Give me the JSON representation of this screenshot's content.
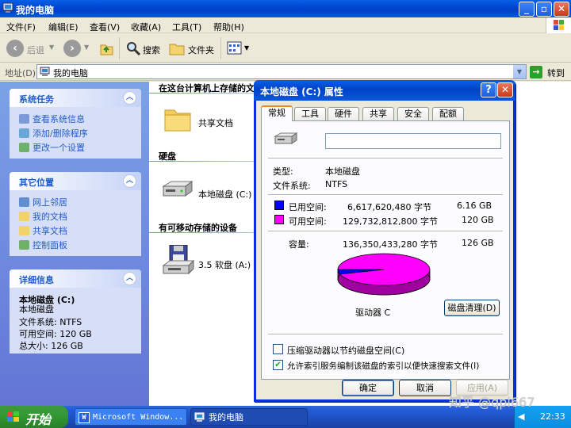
{
  "window": {
    "title": "我的电脑"
  },
  "menu": [
    "文件(F)",
    "编辑(E)",
    "查看(V)",
    "收藏(A)",
    "工具(T)",
    "帮助(H)"
  ],
  "toolbar": {
    "back": "后退",
    "search": "搜索",
    "folders": "文件夹"
  },
  "address": {
    "label": "地址(D)",
    "value": "我的电脑",
    "go": "转到"
  },
  "left": {
    "system_tasks": {
      "title": "系统任务",
      "items": [
        "查看系统信息",
        "添加/删除程序",
        "更改一个设置"
      ]
    },
    "other_places": {
      "title": "其它位置",
      "items": [
        "网上邻居",
        "我的文档",
        "共享文档",
        "控制面板"
      ]
    },
    "details": {
      "title": "详细信息",
      "name": "本地磁盘 (C:)",
      "kind": "本地磁盘",
      "fs": "文件系统: NTFS",
      "free": "可用空间: 120 GB",
      "total": "总大小: 126 GB"
    }
  },
  "right": {
    "group1": "在这台计算机上存储的文",
    "shared_docs": "共享文档",
    "group2": "硬盘",
    "local_disk": "本地磁盘 (C:)",
    "group3": "有可移动存储的设备",
    "floppy": "3.5 软盘 (A:)"
  },
  "dialog": {
    "title": "本地磁盘 (C:) 属性",
    "tabs": [
      "常规",
      "工具",
      "硬件",
      "共享",
      "安全",
      "配额"
    ],
    "label_value": "",
    "type_label": "类型:",
    "type_value": "本地磁盘",
    "fs_label": "文件系统:",
    "fs_value": "NTFS",
    "used_label": "已用空间:",
    "used_bytes": "6,617,620,480 字节",
    "used_gb": "6.16 GB",
    "free_label": "可用空间:",
    "free_bytes": "129,732,812,800 字节",
    "free_gb": "120 GB",
    "cap_label": "容量:",
    "cap_bytes": "136,350,433,280 字节",
    "cap_gb": "126 GB",
    "drive_label": "驱动器 C",
    "cleanup": "磁盘清理(D)",
    "compress": "压缩驱动器以节约磁盘空间(C)",
    "index": "允许索引服务编制该磁盘的索引以便快速搜索文件(I)",
    "ok": "确定",
    "cancel": "取消",
    "apply": "应用(A)",
    "used_color": "#0000ff",
    "free_color": "#ff00ff"
  },
  "taskbar": {
    "start": "开始",
    "task1": "Microsoft Window...",
    "task2": "我的电脑",
    "time": "22:33"
  },
  "watermark": "知乎 @qpi667"
}
